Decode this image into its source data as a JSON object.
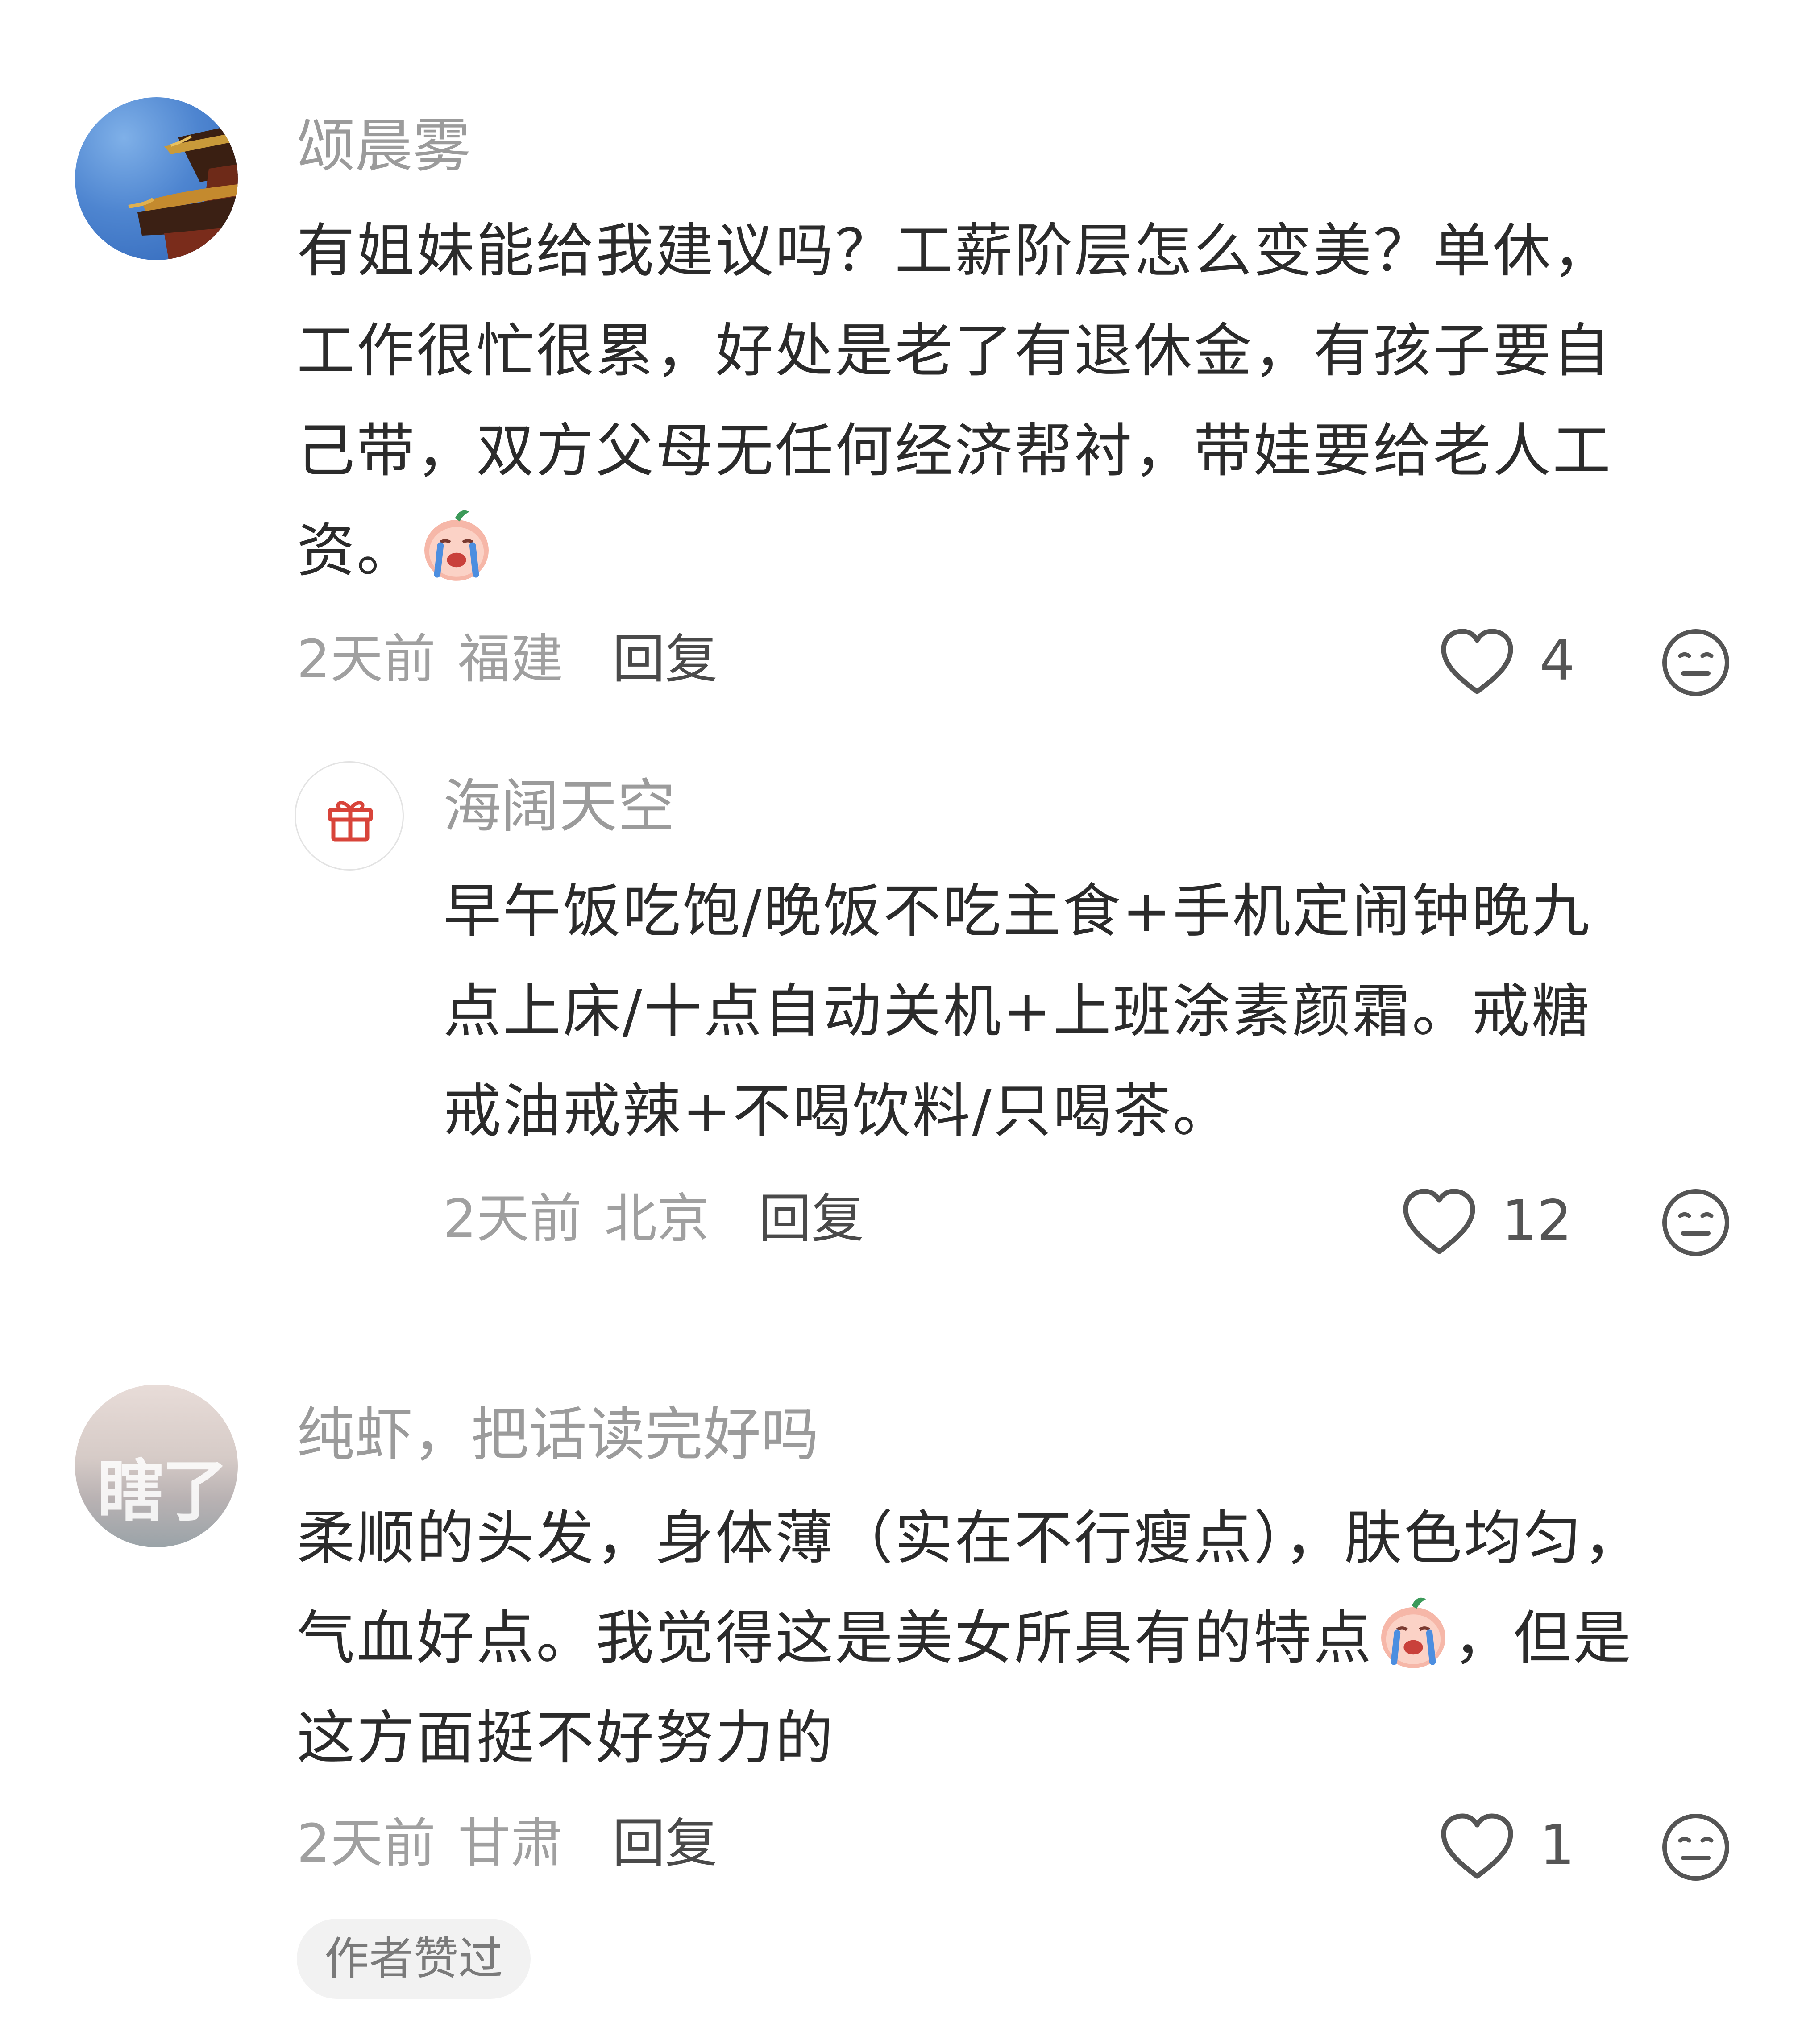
{
  "comments": [
    {
      "username": "颂晨雾",
      "text_lines": [
        "有姐妹能给我建议吗？工薪阶层怎么变美？单休，",
        "工作很忙很累，好处是老了有退休金，有孩子要自",
        "己带，双方父母无任何经济帮衬，带娃要给老人工",
        "资。"
      ],
      "emoji": "crying-face-emoji",
      "time": "2天前",
      "location": "福建",
      "reply_label": "回复",
      "likes": "4",
      "reply": {
        "username": "海阔天空",
        "text_lines": [
          "早午饭吃饱/晚饭不吃主食+手机定闹钟晚九",
          "点上床/十点自动关机+上班涂素颜霜。戒糖",
          "戒油戒辣+不喝饮料/只喝茶。"
        ],
        "time": "2天前",
        "location": "北京",
        "reply_label": "回复",
        "likes": "12"
      }
    },
    {
      "username": "纯虾，把话读完好吗",
      "avatar_text": "瞎了",
      "text_lines": [
        "柔顺的头发，身体薄（实在不行瘦点），肤色均匀，",
        "气血好点。我觉得这是美女所具有的特点",
        "，但是",
        "这方面挺不好努力的"
      ],
      "emoji": "crying-face-emoji",
      "time": "2天前",
      "location": "甘肃",
      "reply_label": "回复",
      "likes": "1",
      "badge": "作者赞过"
    }
  ],
  "colors": {
    "username": "#9b9b9b",
    "text": "#2b2b2b",
    "meta": "#a0a0a0",
    "reply": "#4a4a4a",
    "icon": "#555555",
    "badge_bg": "#f2f2f2"
  },
  "icons": [
    "heart-outline-icon",
    "neutral-face-icon",
    "gift-icon"
  ]
}
